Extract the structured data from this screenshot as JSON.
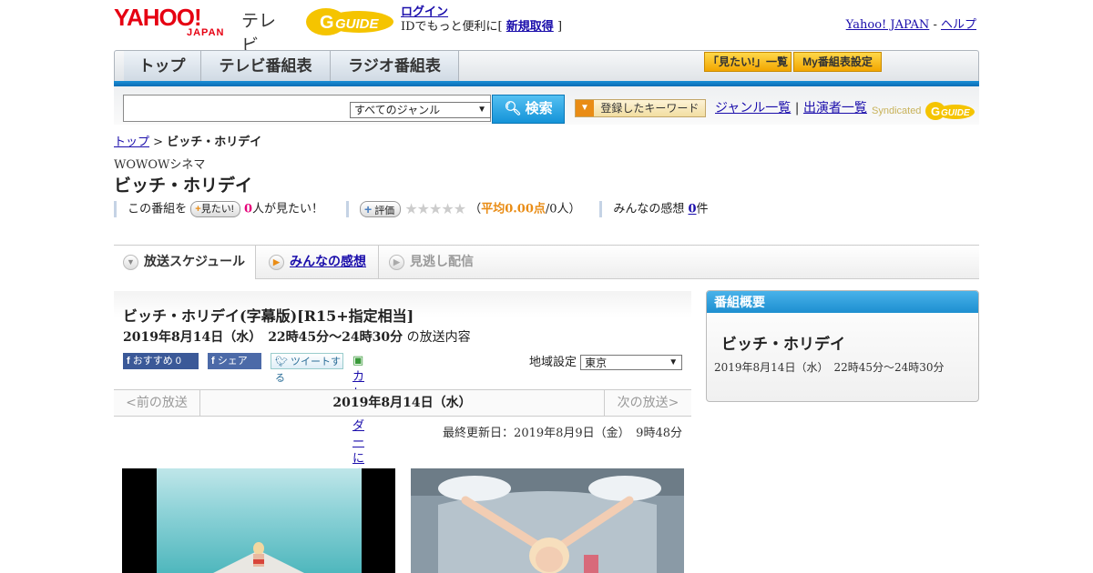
{
  "header": {
    "logo_main": "YAHOO!",
    "logo_sub": "JAPAN",
    "logo_tv": "テレビ",
    "login": "ログイン",
    "id_text": "IDでもっと便利に[",
    "signup": "新規取得",
    "id_text_end": "]",
    "yahoo_japan": "Yahoo! JAPAN",
    "separator": "-",
    "help": "ヘルプ"
  },
  "nav": {
    "tabs": [
      "トップ",
      "テレビ番組表",
      "ラジオ番組表"
    ],
    "mitai_list": "「見たい!」一覧",
    "my_program": "My番組表設定"
  },
  "search": {
    "placeholder": "",
    "genre": "すべてのジャンル",
    "button": "検索",
    "keyword_button": "登録したキーワード",
    "genre_list": "ジャンル一覧",
    "sep": "|",
    "performer_list": "出演者一覧",
    "syndicated": "Syndicated"
  },
  "breadcrumb": {
    "top": "トップ",
    "sep": ">",
    "current": "ビッチ・ホリデイ"
  },
  "program": {
    "channel": "WOWOWシネマ",
    "title": "ビッチ・ホリデイ",
    "want_prefix": "この番組を",
    "want_button": "見たい!",
    "want_count": "0",
    "want_suffix": "人が見たい！",
    "rate_button": "評価",
    "rating_stars": 0,
    "avg_open": "（",
    "avg_label": "平均0.00点",
    "avg_rest": "/0人）",
    "impressions_label": "みんなの感想",
    "impressions_count": "0",
    "impressions_unit": "件"
  },
  "tabs": {
    "schedule": "放送スケジュール",
    "impressions": "みんなの感想",
    "streaming": "見逃し配信"
  },
  "broadcast": {
    "full_title": "ビッチ・ホリデイ(字幕版)[R15+指定相当]",
    "datetime": "2019年8月14日（水）　22時45分～24時30分",
    "datetime_suffix": "の放送内容",
    "fb_recommend": "おすすめ 0",
    "fb_share": "シェア",
    "tweet": "ツイートする",
    "calendar": "カレンダーに登録",
    "region_label": "地域設定",
    "region_value": "東京",
    "prev": "<前の放送",
    "date": "2019年8月14日（水）",
    "next": "次の放送>",
    "updated": "最終更新日：2019年8月9日（金）　9時48分"
  },
  "sidebar": {
    "heading": "番組概要",
    "title": "ビッチ・ホリデイ",
    "time": "2019年8月14日（水）　22時45分～24時30分"
  },
  "colors": {
    "yahoo_red": "#e60012",
    "blue_bar": "#0a6cb4",
    "link": "#1a0dab",
    "accent_orange": "#e98c15",
    "count_pink": "#e6007a"
  }
}
